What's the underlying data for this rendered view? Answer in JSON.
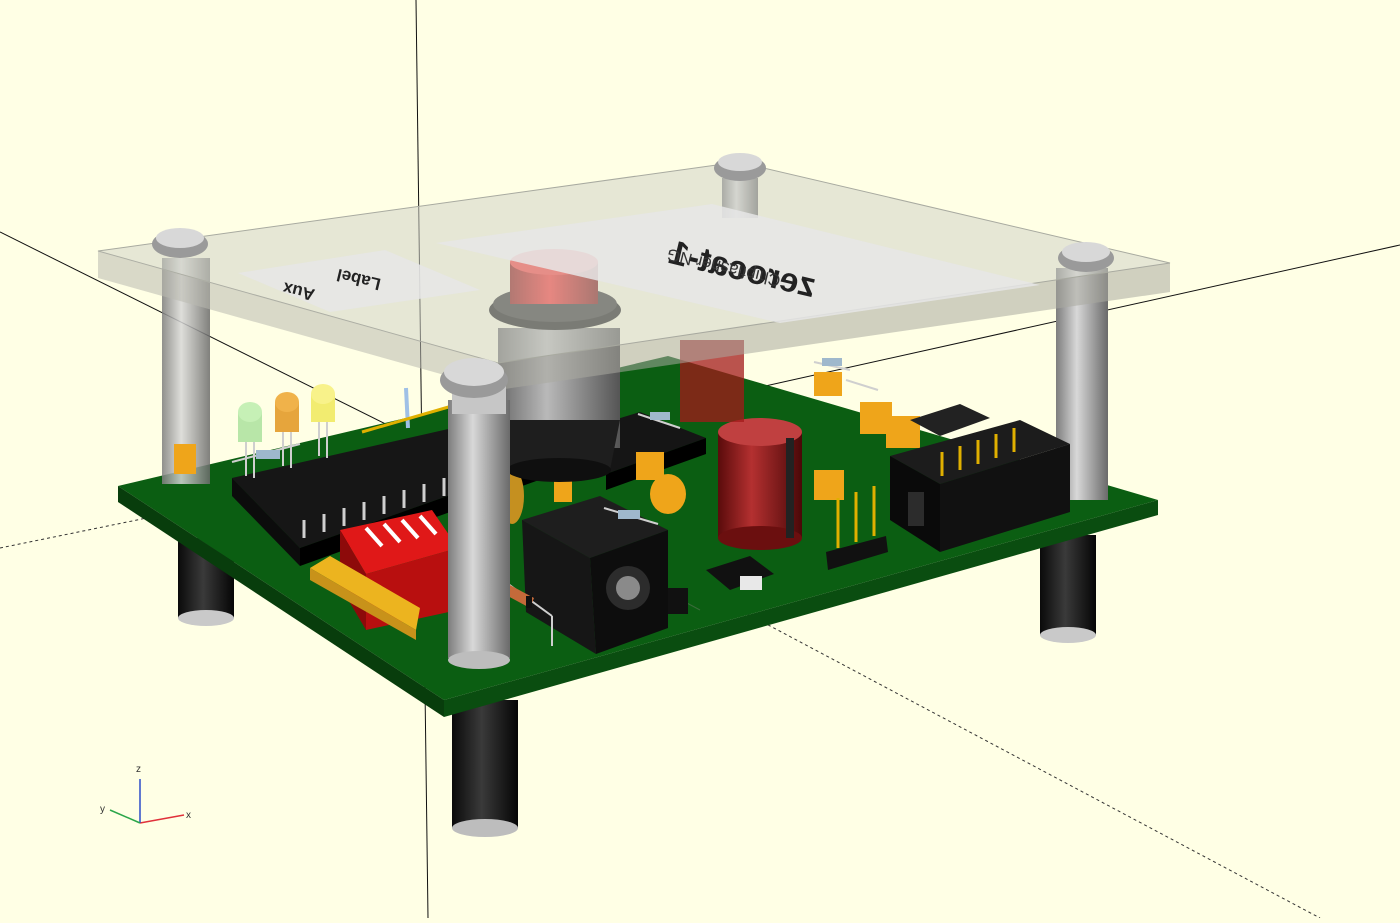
{
  "viewport": {
    "background": "#FFFFE5"
  },
  "lid": {
    "title": "zerocat-1",
    "subtitle": "Chipflasher NG",
    "aux_line1": "Aux",
    "aux_line2": "Label"
  },
  "axes_indicator": {
    "x_label": "x",
    "y_label": "y",
    "z_label": "z"
  },
  "colors": {
    "pcb": "#0B5E12",
    "acrylic": "#D2D3C8",
    "standoff": "#3A3A3A",
    "button": "#D8141A",
    "capacitor": "#EFA51A"
  }
}
